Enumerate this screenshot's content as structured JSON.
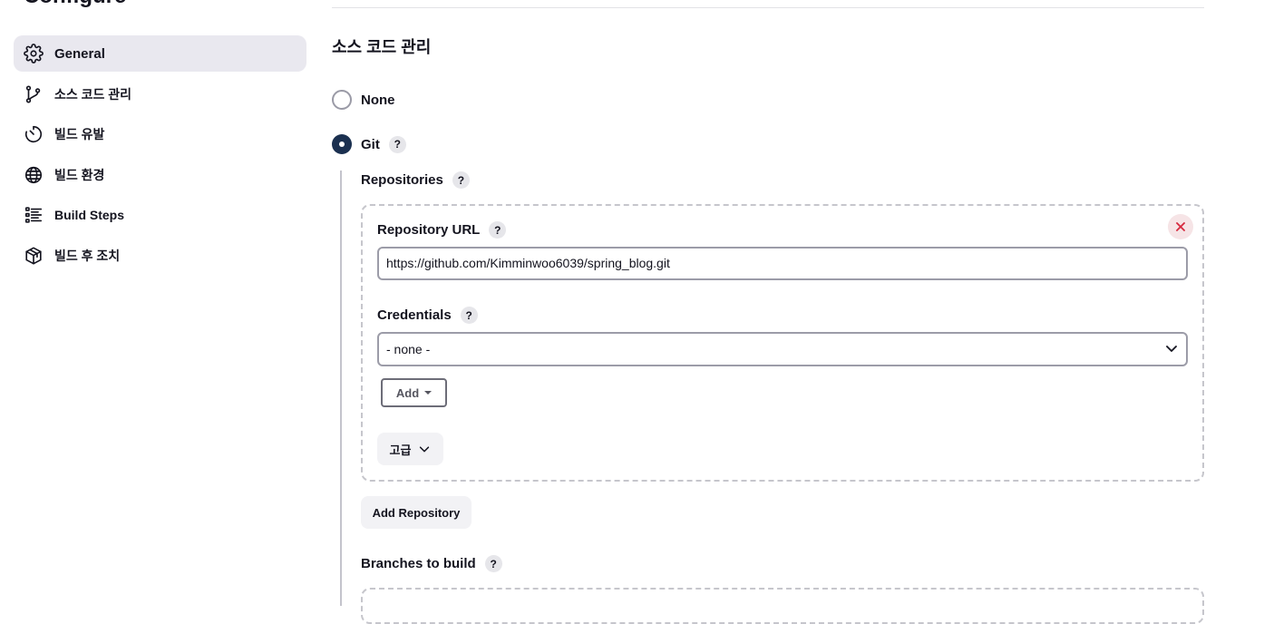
{
  "page": {
    "title": "Configure"
  },
  "sidebar": {
    "items": [
      {
        "label": "General",
        "icon": "gear-icon",
        "active": true
      },
      {
        "label": "소스 코드 관리",
        "icon": "branch-icon",
        "active": false
      },
      {
        "label": "빌드 유발",
        "icon": "timer-icon",
        "active": false
      },
      {
        "label": "빌드 환경",
        "icon": "globe-icon",
        "active": false
      },
      {
        "label": "Build Steps",
        "icon": "list-icon",
        "active": false
      },
      {
        "label": "빌드 후 조치",
        "icon": "package-icon",
        "active": false
      }
    ]
  },
  "scm": {
    "section_title": "소스 코드 관리",
    "options": [
      {
        "label": "None",
        "checked": false
      },
      {
        "label": "Git",
        "checked": true
      }
    ],
    "help_glyph": "?"
  },
  "git": {
    "repositories_label": "Repositories",
    "repository_url_label": "Repository URL",
    "repository_url_value": "https://github.com/Kimminwoo6039/spring_blog.git",
    "credentials_label": "Credentials",
    "credentials_selected": "- none -",
    "add_button_label": "Add",
    "advanced_button_label": "고급",
    "add_repository_label": "Add Repository",
    "branches_label": "Branches to build"
  },
  "colors": {
    "accent": "#1b3050",
    "danger": "#d6293e",
    "active_bg": "#e9e8ef"
  }
}
